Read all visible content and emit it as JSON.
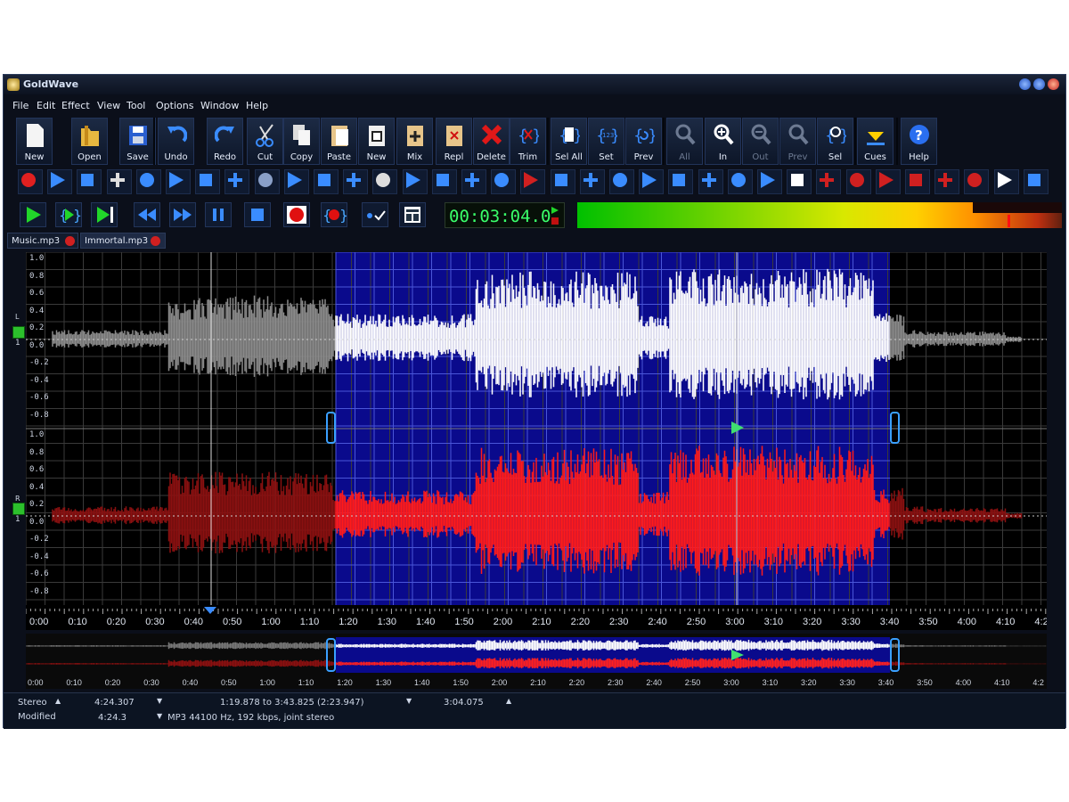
{
  "window": {
    "title": "GoldWave"
  },
  "menu": [
    "File",
    "Edit",
    "Effect",
    "View",
    "Tool",
    "Options",
    "Window",
    "Help"
  ],
  "toolbar": {
    "buttons": [
      {
        "label": "New",
        "icon": "new-file-icon"
      },
      {
        "label": "Open",
        "icon": "open-folder-icon"
      },
      {
        "label": "Save",
        "icon": "save-disk-icon"
      },
      {
        "label": "Undo",
        "icon": "undo-icon"
      },
      {
        "label": "Redo",
        "icon": "redo-icon"
      },
      {
        "label": "Cut",
        "icon": "scissors-icon"
      },
      {
        "label": "Copy",
        "icon": "copy-icon"
      },
      {
        "label": "Paste",
        "icon": "paste-icon"
      },
      {
        "label": "New",
        "icon": "paste-new-icon"
      },
      {
        "label": "Mix",
        "icon": "mix-icon"
      },
      {
        "label": "Repl",
        "icon": "replace-icon"
      },
      {
        "label": "Delete",
        "icon": "delete-x-icon"
      },
      {
        "label": "Trim",
        "icon": "trim-icon"
      },
      {
        "label": "Sel All",
        "icon": "select-all-icon"
      },
      {
        "label": "Set",
        "icon": "set-selection-icon"
      },
      {
        "label": "Prev",
        "icon": "previous-selection-icon"
      },
      {
        "label": "All",
        "icon": "zoom-all-icon",
        "disabled": true
      },
      {
        "label": "In",
        "icon": "zoom-in-icon"
      },
      {
        "label": "Out",
        "icon": "zoom-out-icon",
        "disabled": true
      },
      {
        "label": "Prev",
        "icon": "zoom-previous-icon",
        "disabled": true
      },
      {
        "label": "Sel",
        "icon": "zoom-selection-icon"
      },
      {
        "label": "Cues",
        "icon": "cues-icon"
      },
      {
        "label": "Help",
        "icon": "help-icon"
      }
    ]
  },
  "transport": {
    "time": "00:03:04.0"
  },
  "tabs": [
    {
      "label": "Music.mp3"
    },
    {
      "label": "Immortal.mp3"
    }
  ],
  "scale_labels": [
    "1.0",
    "0.8",
    "0.6",
    "0.4",
    "0.2",
    "0.0",
    "-0.2",
    "-0.4",
    "-0.6",
    "-0.8"
  ],
  "channels": {
    "left": "L",
    "right": "R",
    "left_num": "1",
    "right_num": "1"
  },
  "timeline_labels": [
    "0:00",
    "0:10",
    "0:20",
    "0:30",
    "0:40",
    "0:50",
    "1:00",
    "1:10",
    "1:20",
    "1:30",
    "1:40",
    "1:50",
    "2:00",
    "2:10",
    "2:20",
    "2:30",
    "2:40",
    "2:50",
    "3:00",
    "3:10",
    "3:20",
    "3:30",
    "3:40",
    "3:50",
    "4:00",
    "4:10",
    "4:2"
  ],
  "status": {
    "channel": "Stereo",
    "length": "4:24.307",
    "selection": "1:19.878 to 3:43.825 (2:23.947)",
    "position": "3:04.075",
    "state": "Modified",
    "length2": "4:24.3",
    "format": "MP3 44100 Hz, 192 kbps, joint stereo"
  },
  "colors": {
    "selection": "#0a0a8c",
    "left_wave": "#ffffff",
    "right_wave": "#ff1a1a",
    "time_text": "#3aff6a"
  }
}
